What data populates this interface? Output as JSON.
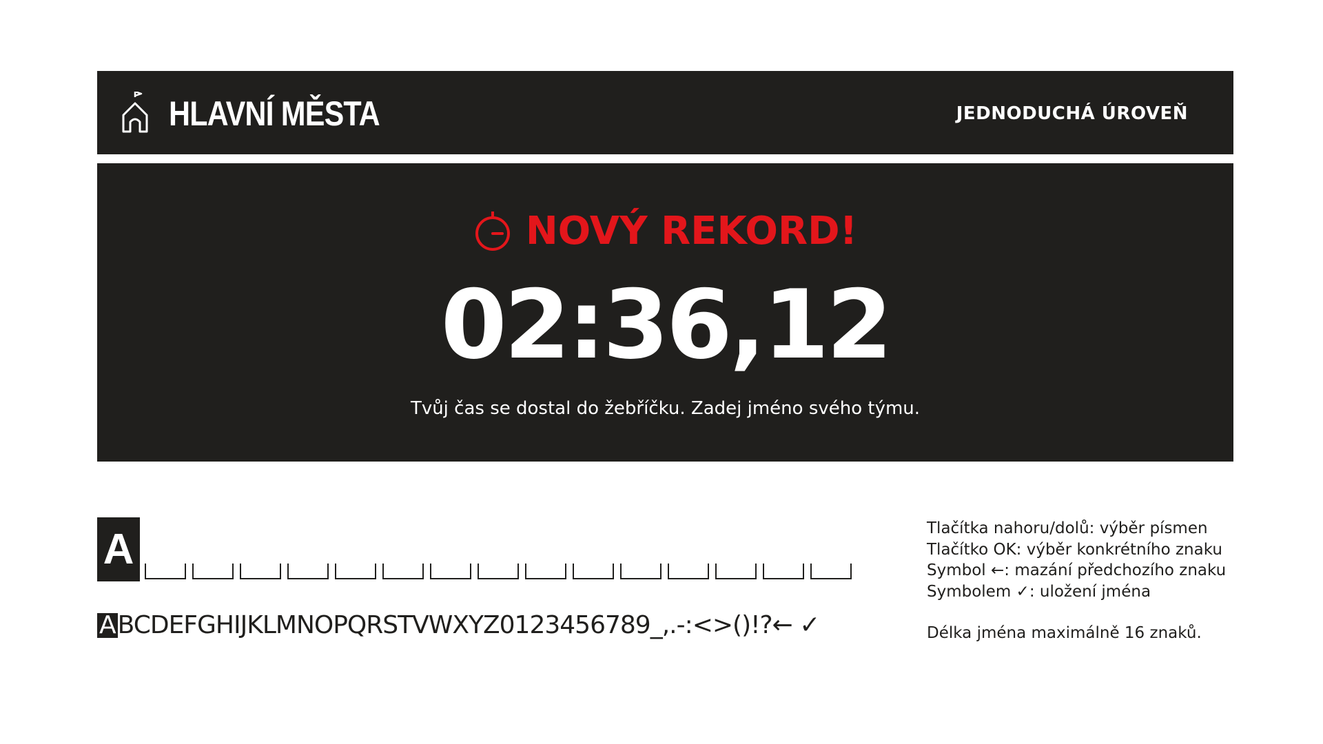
{
  "header": {
    "title": "HLAVNÍ MĚSTA",
    "level": "JEDNODUCHÁ ÚROVEŇ",
    "icon": "home-flag-icon"
  },
  "record": {
    "label": "NOVÝ REKORD!",
    "icon": "stopwatch-icon",
    "time": "02:36,12",
    "message": "Tvůj čas se dostal do žebříčku. Zadej jméno svého týmu."
  },
  "name_entry": {
    "current_char": "A",
    "slot_count": 15,
    "charset_selected": "A",
    "charset_rest": "BCDEFGHIJKLMNOPQRSTVWXYZ0123456789_,.-:<>()!?← ✓"
  },
  "instructions": {
    "line1": "Tlačítka nahoru/dolů: výběr písmen",
    "line2": "Tlačítko OK: výběr konkrétního znaku",
    "line3": "Symbol ←: mazání předchozího znaku",
    "line4": "Symbolem  ✓: uložení jména",
    "line5": "Délka jména maximálně 16  znaků."
  },
  "colors": {
    "panel": "#201f1d",
    "accent_red": "#e3161b",
    "text_light": "#ffffff"
  }
}
